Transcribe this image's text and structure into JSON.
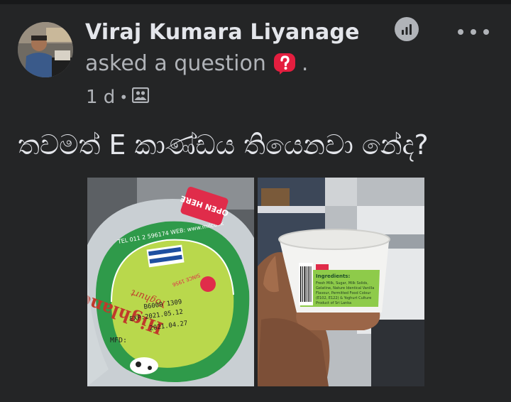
{
  "post": {
    "author": "Viraj Kumara Liyanage",
    "action": "asked a question",
    "action_suffix": ".",
    "time": "1 d",
    "separator": "•",
    "audience_icon": "group-audience-icon",
    "text": "තවමත් E කාණ්ඩය තියෙනවා නේද?"
  },
  "icons": {
    "question": "question-badge-icon",
    "insights": "insights-chart-icon",
    "more": "more-options-icon"
  },
  "photo1": {
    "lid_text_top": "TEL 011 2 596174 WEB: www.milco.lk",
    "open_here": "OPEN HERE",
    "since": "SINCE 1956",
    "brand": "Highland",
    "product": "Yoghurt",
    "batch": "B6000 1309",
    "exp": "EXP:2021.05.12",
    "mfd_date": "2021.04.27",
    "mfd_label": "MFD:"
  },
  "photo2": {
    "cup_label": "Ingredients:",
    "ingredients_line1": "Fresh Milk, Sugar, Milk Solids,",
    "ingredients_line2": "Gelatine, Nature Identical Vanilla",
    "ingredients_line3": "Flavour, Permitted Food Colour",
    "ingredients_line4": "(E102, E122) & Yoghurt Culture",
    "ingredients_line5": "Product of Sri Lanka"
  },
  "colors": {
    "background": "#242526",
    "primary_text": "#e4e6eb",
    "secondary_text": "#b0b3b8",
    "question_red": "#e41e3f"
  }
}
